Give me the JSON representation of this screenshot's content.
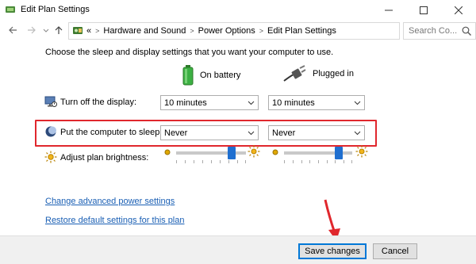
{
  "window": {
    "title": "Edit Plan Settings",
    "controls": [
      "minimize",
      "maximize",
      "close"
    ]
  },
  "address": {
    "overflow": "«",
    "breadcrumbs": [
      "Hardware and Sound",
      "Power Options",
      "Edit Plan Settings"
    ],
    "search_placeholder": "Search Co..."
  },
  "main": {
    "heading": "Choose the sleep and display settings that you want your computer to use.",
    "columns": {
      "battery": "On battery",
      "plugged": "Plugged in"
    },
    "display_row": {
      "label": "Turn off the display:",
      "battery_value": "10 minutes",
      "plugged_value": "10 minutes"
    },
    "sleep_row": {
      "label": "Put the computer to sleep:",
      "battery_value": "Never",
      "plugged_value": "Never"
    },
    "brightness_row": {
      "label": "Adjust plan brightness:",
      "battery_level": 0.8,
      "plugged_level": 0.8
    },
    "links": {
      "advanced": "Change advanced power settings",
      "restore": "Restore default settings for this plan"
    }
  },
  "footer": {
    "save_label": "Save changes",
    "cancel_label": "Cancel"
  },
  "colors": {
    "highlight": "#e0272d",
    "link": "#1a5fb4",
    "slider_thumb": "#1f6fd0",
    "battery_green": "#3cb043"
  },
  "icons": [
    "app-icon",
    "back-icon",
    "forward-icon",
    "up-icon",
    "control-panel-icon",
    "chevron-down-icon",
    "refresh-icon",
    "search-icon",
    "battery-icon",
    "plug-icon",
    "display-icon",
    "sleep-icon",
    "brightness-icon",
    "sun-dim-icon",
    "sun-bright-icon",
    "red-arrow-annotation"
  ]
}
